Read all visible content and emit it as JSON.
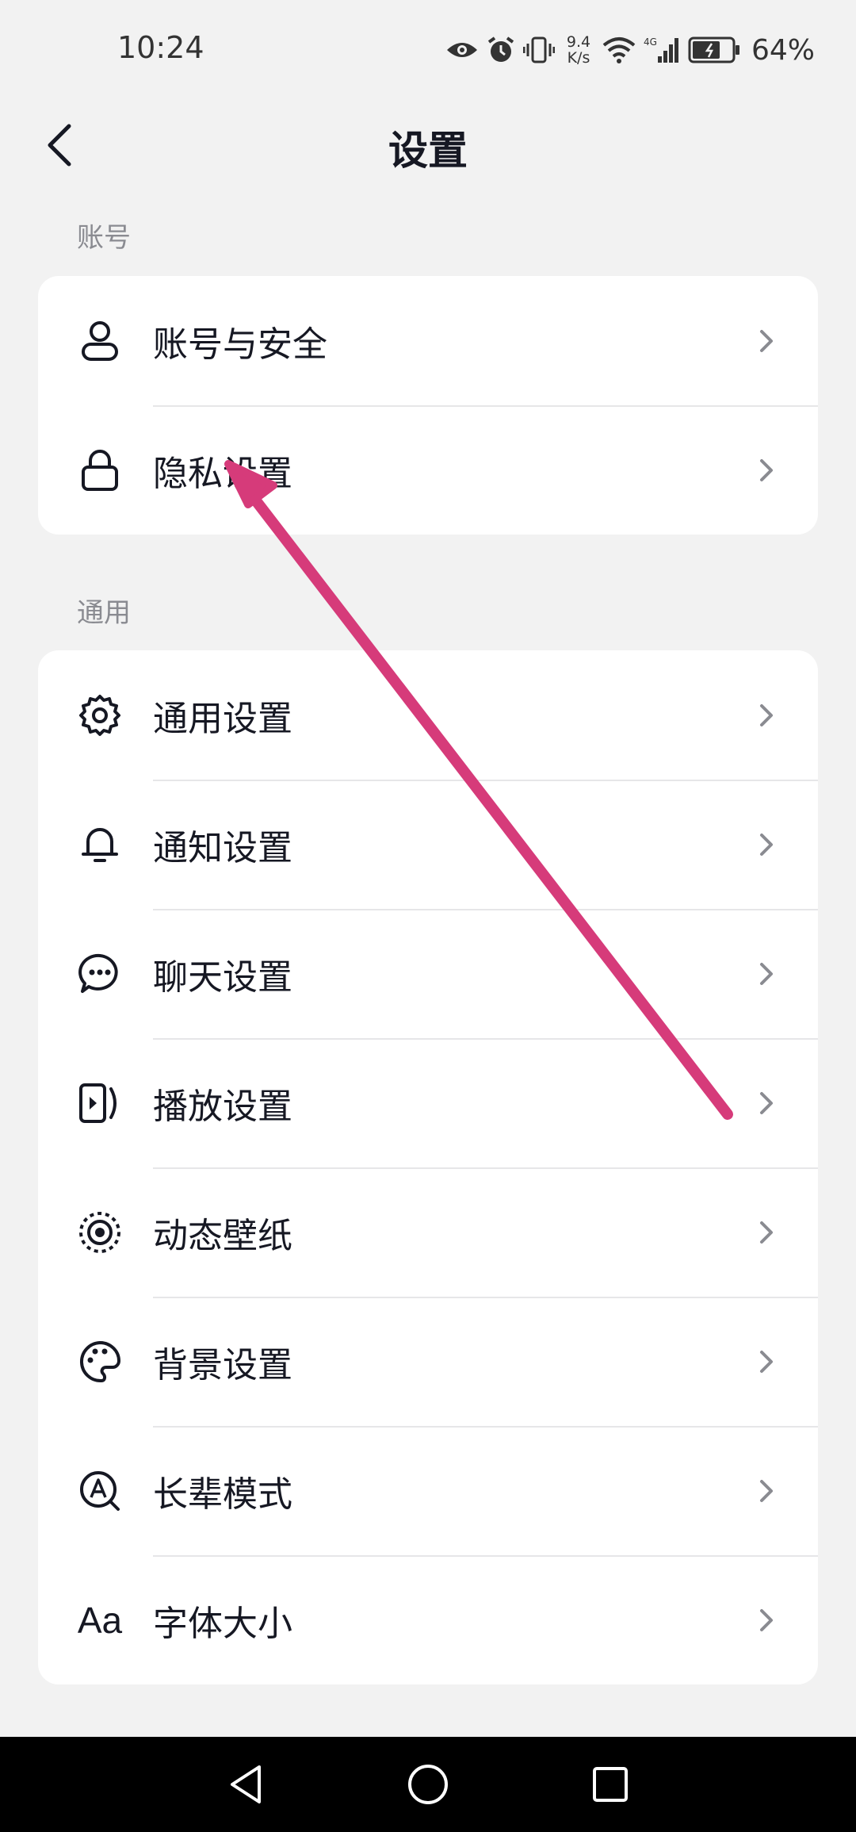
{
  "status": {
    "time": "10:24",
    "net_speed_value": "9.4",
    "net_speed_unit": "K/s",
    "network_type": "4G",
    "battery": "64%"
  },
  "header": {
    "title": "设置"
  },
  "sections": [
    {
      "label": "账号",
      "items": [
        {
          "label": "账号与安全",
          "icon": "person-icon"
        },
        {
          "label": "隐私设置",
          "icon": "lock-icon"
        }
      ]
    },
    {
      "label": "通用",
      "items": [
        {
          "label": "通用设置",
          "icon": "gear-icon"
        },
        {
          "label": "通知设置",
          "icon": "bell-icon"
        },
        {
          "label": "聊天设置",
          "icon": "chat-bubble-icon"
        },
        {
          "label": "播放设置",
          "icon": "play-icon"
        },
        {
          "label": "动态壁纸",
          "icon": "wallpaper-icon"
        },
        {
          "label": "背景设置",
          "icon": "palette-icon"
        },
        {
          "label": "长辈模式",
          "icon": "elder-mode-icon"
        },
        {
          "label": "字体大小",
          "icon": "font-size-icon",
          "icon_text": "Aa"
        }
      ]
    }
  ],
  "annotation": {
    "color": "#d63b7a"
  },
  "colors": {
    "background": "#f2f2f2",
    "card": "#ffffff",
    "text": "#161823",
    "secondary_text": "#8a8b91"
  }
}
